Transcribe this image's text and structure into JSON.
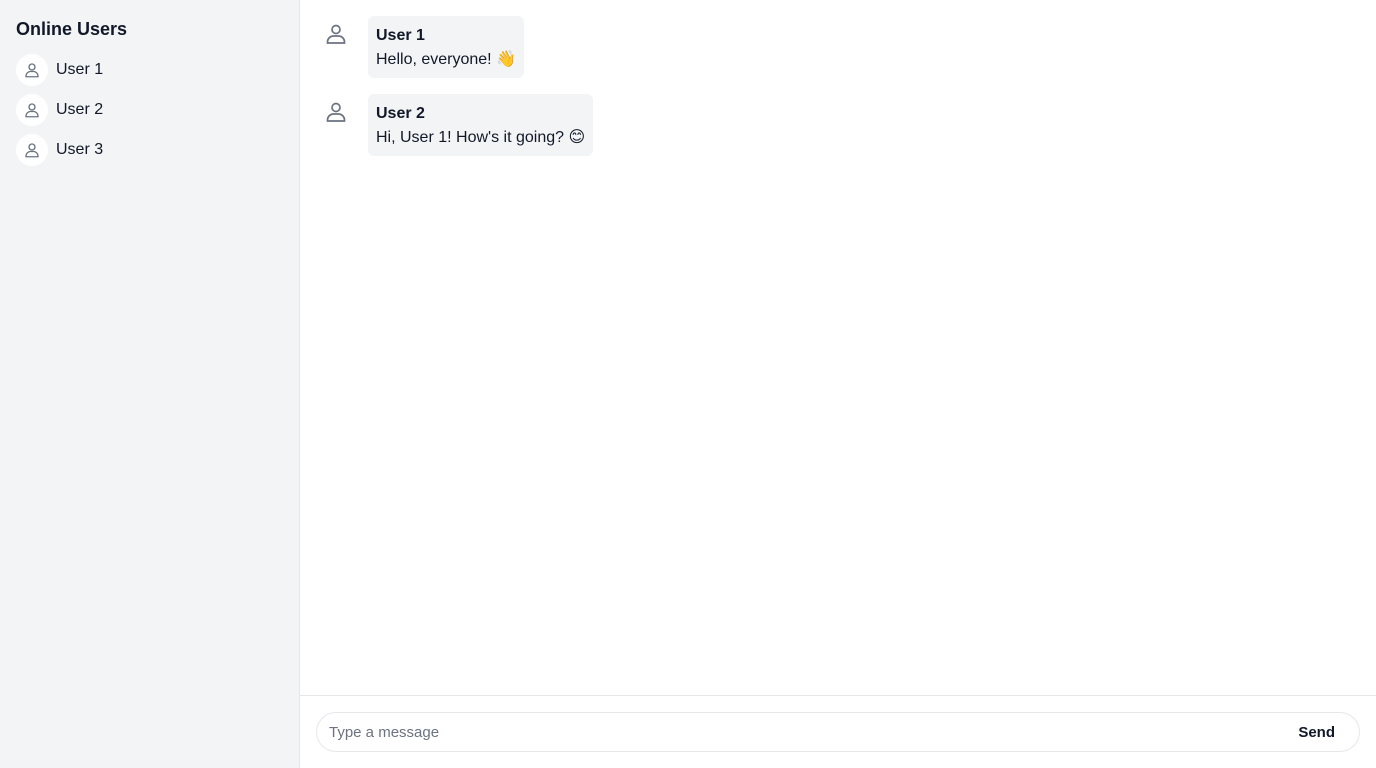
{
  "sidebar": {
    "title": "Online Users",
    "users": [
      {
        "name": "User 1",
        "icon": "user-icon"
      },
      {
        "name": "User 2",
        "icon": "user-icon"
      },
      {
        "name": "User 3",
        "icon": "user-icon"
      }
    ]
  },
  "messages": [
    {
      "author": "User 1",
      "text": "Hello, everyone! 👋",
      "icon": "user-icon"
    },
    {
      "author": "User 2",
      "text": "Hi, User 1! How's it going? 😊",
      "icon": "user-icon"
    }
  ],
  "composer": {
    "placeholder": "Type a message",
    "value": "",
    "send_label": "Send"
  },
  "colors": {
    "sidebar_bg": "#f3f4f6",
    "bubble_bg": "#f3f4f6",
    "border": "#e5e7eb",
    "icon": "#6b7280"
  }
}
